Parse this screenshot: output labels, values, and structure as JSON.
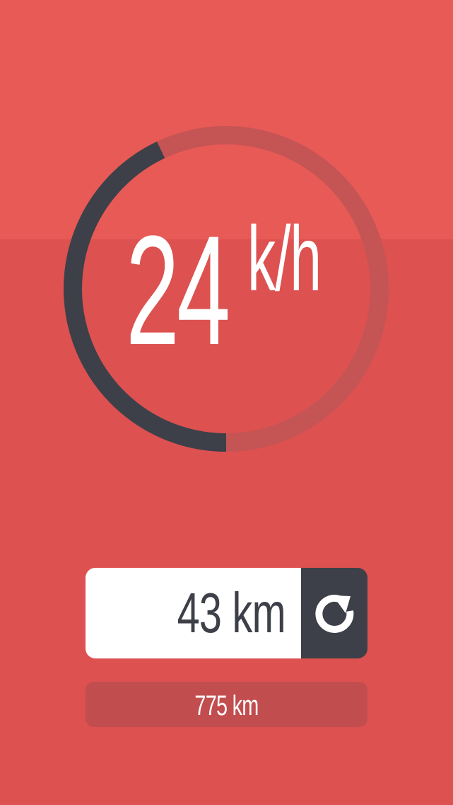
{
  "speedometer": {
    "speed_value": "24",
    "speed_unit": "k/h",
    "gauge_level": 0.43,
    "colors": {
      "track": "#c55454",
      "progress": "#3d4048"
    }
  },
  "trip": {
    "distance": "43 km",
    "reset_icon": "reset-arrow-icon"
  },
  "total": {
    "distance": "775 km"
  },
  "colors": {
    "background_top": "#e85a56",
    "background_bottom": "#dd5151",
    "trip_box": "#ffffff",
    "dark": "#3d4048",
    "total_box": "#c24d4e"
  }
}
